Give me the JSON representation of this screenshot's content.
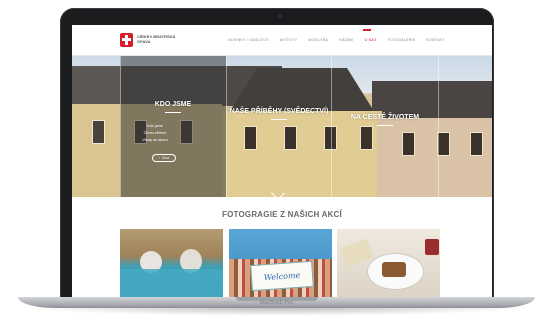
{
  "device": {
    "label": "MacBook Pro"
  },
  "site": {
    "logo_text": "CÍRKEV BRATRSKÁ OPAVA",
    "nav": [
      {
        "label": "Novinky / události",
        "active": false
      },
      {
        "label": "Aktivity",
        "active": false
      },
      {
        "label": "Modlitba",
        "active": false
      },
      {
        "label": "Kázání",
        "active": false
      },
      {
        "label": "O nás",
        "active": true
      },
      {
        "label": "Fotogalerie",
        "active": false
      },
      {
        "label": "Kontakt",
        "active": false
      }
    ],
    "hero": {
      "panels": [
        {
          "title": "KDO JSME",
          "links": [
            "Kdo jsme",
            "Čemu věříme",
            "Vstup do sboru"
          ],
          "button": "Více"
        },
        {
          "title": "NAŠE PŘÍBĚHY (SVĚDECTVÍ)"
        },
        {
          "title": "NA CESTĚ ŽIVOTEM"
        }
      ]
    },
    "section_title": "FOTOGRAGIE Z NAŠICH AKCÍ",
    "photos": [
      {
        "icon": "baptism-photo"
      },
      {
        "icon": "group-welcome-photo",
        "sign_text": "Welcome"
      },
      {
        "icon": "communion-photo"
      }
    ],
    "colors": {
      "accent": "#d71f2b",
      "panel_overlay": "#3c3c3c"
    }
  }
}
